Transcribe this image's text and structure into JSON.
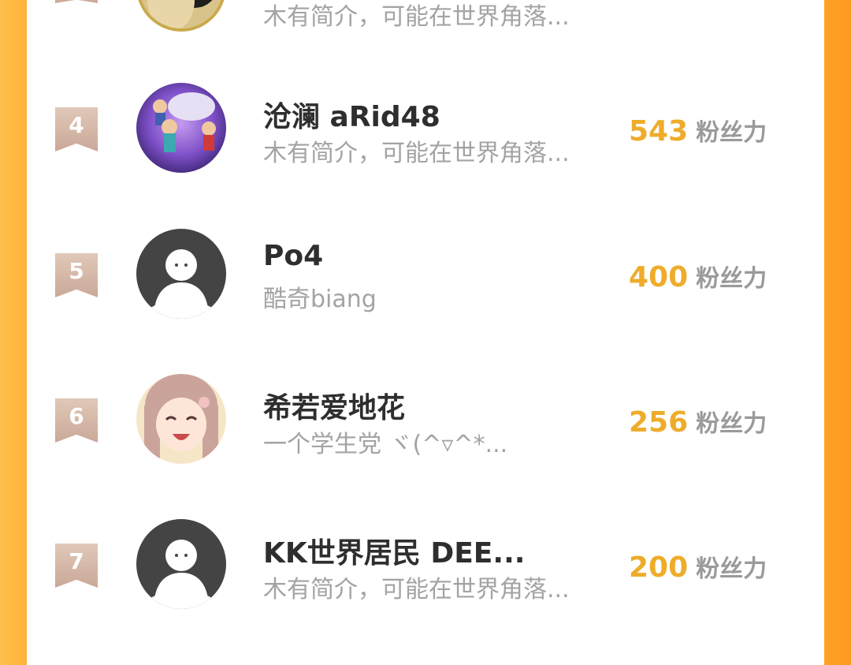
{
  "ranking": {
    "rows": [
      {
        "rank": "",
        "name": "",
        "bio": "木有简介，可能在世界角落...",
        "fans": "",
        "fans_label": "",
        "avatar": "photo-avatar-gold"
      },
      {
        "rank": "4",
        "name": "沧澜 aRid48",
        "bio": "木有简介，可能在世界角落...",
        "fans": "543",
        "fans_label": "粉丝力",
        "avatar": "cartoon-avatar"
      },
      {
        "rank": "5",
        "name": "Po4",
        "bio": "酷奇biang",
        "fans": "400",
        "fans_label": "粉丝力",
        "avatar": "default-avatar"
      },
      {
        "rank": "6",
        "name": "希若爱地花",
        "bio": "一个学生党 ヾ(^▿^*...",
        "fans": "256",
        "fans_label": "粉丝力",
        "avatar": "anime-avatar"
      },
      {
        "rank": "7",
        "name": "KK世界居民 DEE...",
        "bio": "木有简介，可能在世界角落...",
        "fans": "200",
        "fans_label": "粉丝力",
        "avatar": "default-avatar"
      }
    ]
  },
  "colors": {
    "fans_number": "#eeac2a",
    "rank_ribbon": "#d4b6a6",
    "background_left": "#ffb238",
    "background_right": "#ff9a1f"
  }
}
